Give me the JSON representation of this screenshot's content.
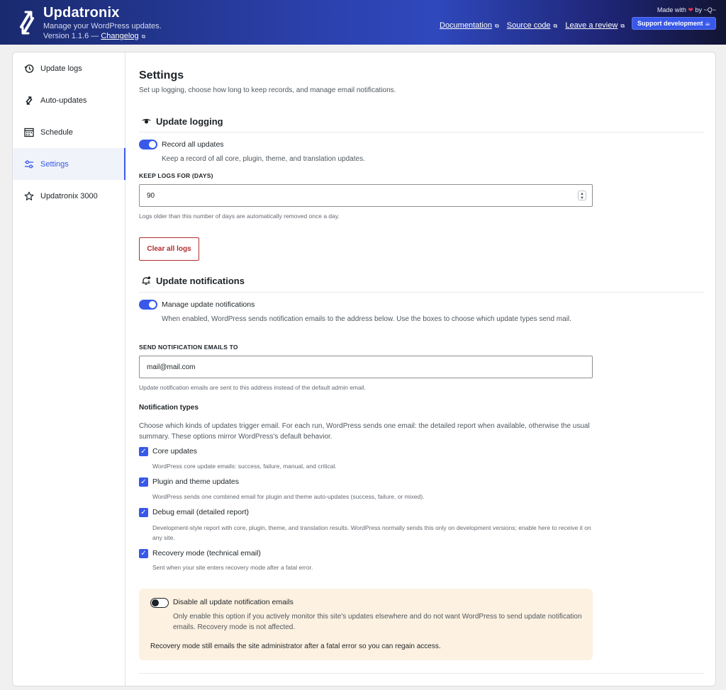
{
  "header": {
    "title": "Updatronix",
    "tagline": "Manage your WordPress updates.",
    "version_prefix": "Version 1.1.6 —",
    "changelog_label": "Changelog",
    "made_with_prefix": "Made with",
    "made_with_suffix": "by ~Q~",
    "links": [
      "Documentation",
      "Source code",
      "Leave a review"
    ],
    "support_label": "Support development ☕"
  },
  "sidebar": {
    "items": [
      {
        "label": "Update logs",
        "icon": "history-icon"
      },
      {
        "label": "Auto-updates",
        "icon": "sync-icon"
      },
      {
        "label": "Schedule",
        "icon": "calendar-icon"
      },
      {
        "label": "Settings",
        "icon": "sliders-icon",
        "active": true
      },
      {
        "label": "Updatronix 3000",
        "icon": "star-icon"
      }
    ]
  },
  "settings": {
    "title": "Settings",
    "subtitle": "Set up logging, choose how long to keep records, and manage email notifications.",
    "logging": {
      "heading": "Update logging",
      "record_label": "Record all updates",
      "record_on": true,
      "record_help": "Keep a record of all core, plugin, theme, and translation updates.",
      "keep_label": "KEEP LOGS FOR (DAYS)",
      "keep_value": "90",
      "keep_help": "Logs older than this number of days are automatically removed once a day.",
      "clear_label": "Clear all logs"
    },
    "notifications": {
      "heading": "Update notifications",
      "manage_label": "Manage update notifications",
      "manage_on": true,
      "manage_help": "When enabled, WordPress sends notification emails to the address below. Use the boxes to choose which update types send mail.",
      "email_label": "SEND NOTIFICATION EMAILS TO",
      "email_value": "mail@mail.com",
      "email_help": "Update notification emails are sent to this address instead of the default admin email.",
      "types_heading": "Notification types",
      "types_help": "Choose which kinds of updates trigger email. For each run, WordPress sends one email: the detailed report when available, otherwise the usual summary. These options mirror WordPress's default behavior.",
      "types": [
        {
          "label": "Core updates",
          "checked": true,
          "help": "WordPress core update emails: success, failure, manual, and critical."
        },
        {
          "label": "Plugin and theme updates",
          "checked": true,
          "help": "WordPress sends one combined email for plugin and theme auto-updates (success, failure, or mixed)."
        },
        {
          "label": "Debug email (detailed report)",
          "checked": true,
          "help": "Development-style report with core, plugin, theme, and translation results. WordPress normally sends this only on development versions; enable here to receive it on any site."
        },
        {
          "label": "Recovery mode (technical email)",
          "checked": true,
          "help": "Sent when your site enters recovery mode after a fatal error."
        }
      ],
      "disable_label": "Disable all update notification emails",
      "disable_on": false,
      "disable_help": "Only enable this option if you actively monitor this site's updates elsewhere and do not want WordPress to send update notification emails. Recovery mode is not affected.",
      "disable_note": "Recovery mode still emails the site administrator after a fatal error so you can regain access."
    }
  },
  "colors": {
    "accent": "#3858e9",
    "danger": "#b32d2e",
    "warning_bg": "#fdf1e1"
  }
}
